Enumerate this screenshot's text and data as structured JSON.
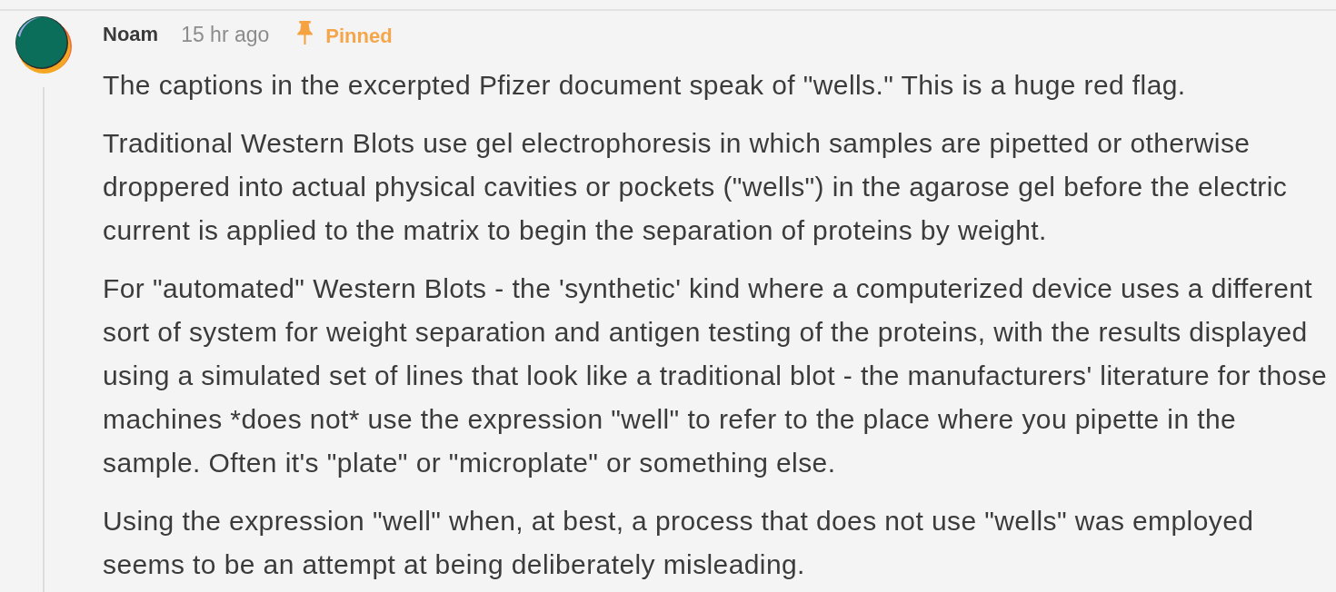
{
  "comment": {
    "author": "Noam",
    "time": "15 hr ago",
    "pinned": true,
    "pinned_label": "Pinned",
    "paragraphs": [
      "The captions in the excerpted Pfizer document speak of \"wells.\" This is a huge red flag.",
      "Traditional Western Blots use gel electrophoresis in which samples are pipetted or otherwise droppered into actual physical cavities or pockets (\"wells\") in the agarose gel before the electric current is applied to the matrix to begin the separation of proteins by weight.",
      "For \"automated\" Western Blots - the 'synthetic' kind where a computerized device uses a different sort of system for weight separation and antigen testing of the proteins, with the results displayed using a simulated set of lines that look like a traditional blot - the manufacturers' literature for those machines *does not* use the expression \"well\" to refer to the place where you pipette in the sample. Often it's \"plate\" or \"microplate\" or something else.",
      "Using the expression \"well\" when, at best, a process that does not use \"wells\" was employed seems to be an attempt at being deliberately misleading."
    ]
  }
}
